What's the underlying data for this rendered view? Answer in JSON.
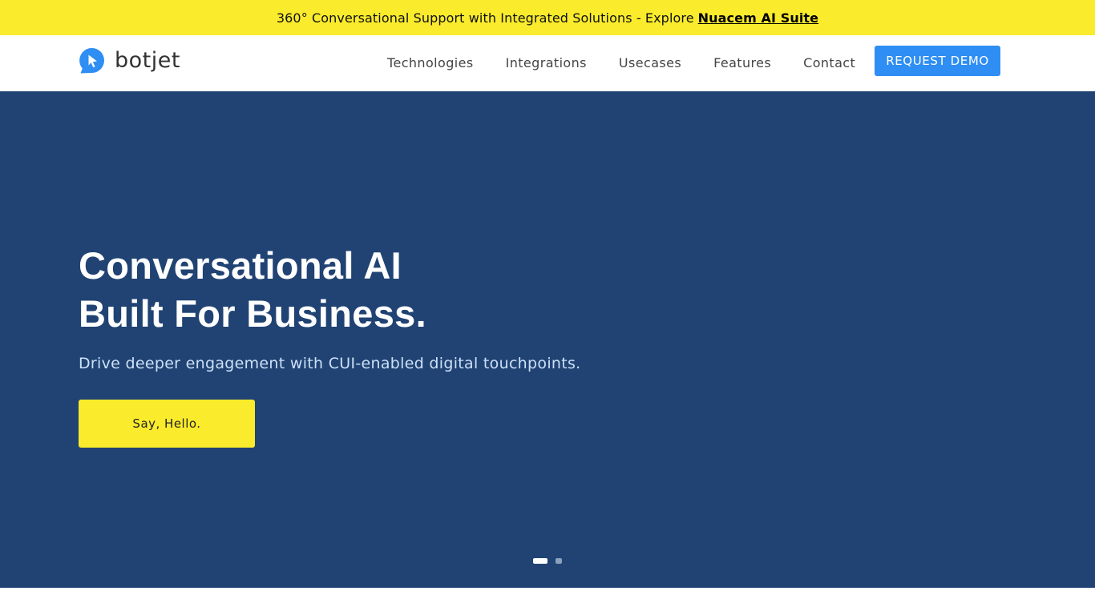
{
  "announcement": {
    "text": "360° Conversational Support with Integrated Solutions - Explore",
    "link_label": "Nuacem AI Suite"
  },
  "header": {
    "logo_text": "botjet",
    "logo_icon": "chat-bubble-cursor-icon",
    "nav": [
      {
        "label": "Technologies"
      },
      {
        "label": "Integrations"
      },
      {
        "label": "Usecases"
      },
      {
        "label": "Features"
      },
      {
        "label": "Contact"
      }
    ],
    "cta_label": "REQUEST DEMO"
  },
  "hero": {
    "title_line1": "Conversational AI",
    "title_line2": "Built For Business.",
    "subtitle": "Drive deeper engagement with CUI-enabled digital touchpoints.",
    "button_label": "Say, Hello.",
    "slides_total": 2,
    "active_slide": 1
  },
  "colors": {
    "announcement_bg": "#faeb2c",
    "hero_bg": "#204373",
    "cta_bg": "#2e8ef3",
    "hero_button_bg": "#faeb2c",
    "subtitle_text": "#cde0f8"
  }
}
